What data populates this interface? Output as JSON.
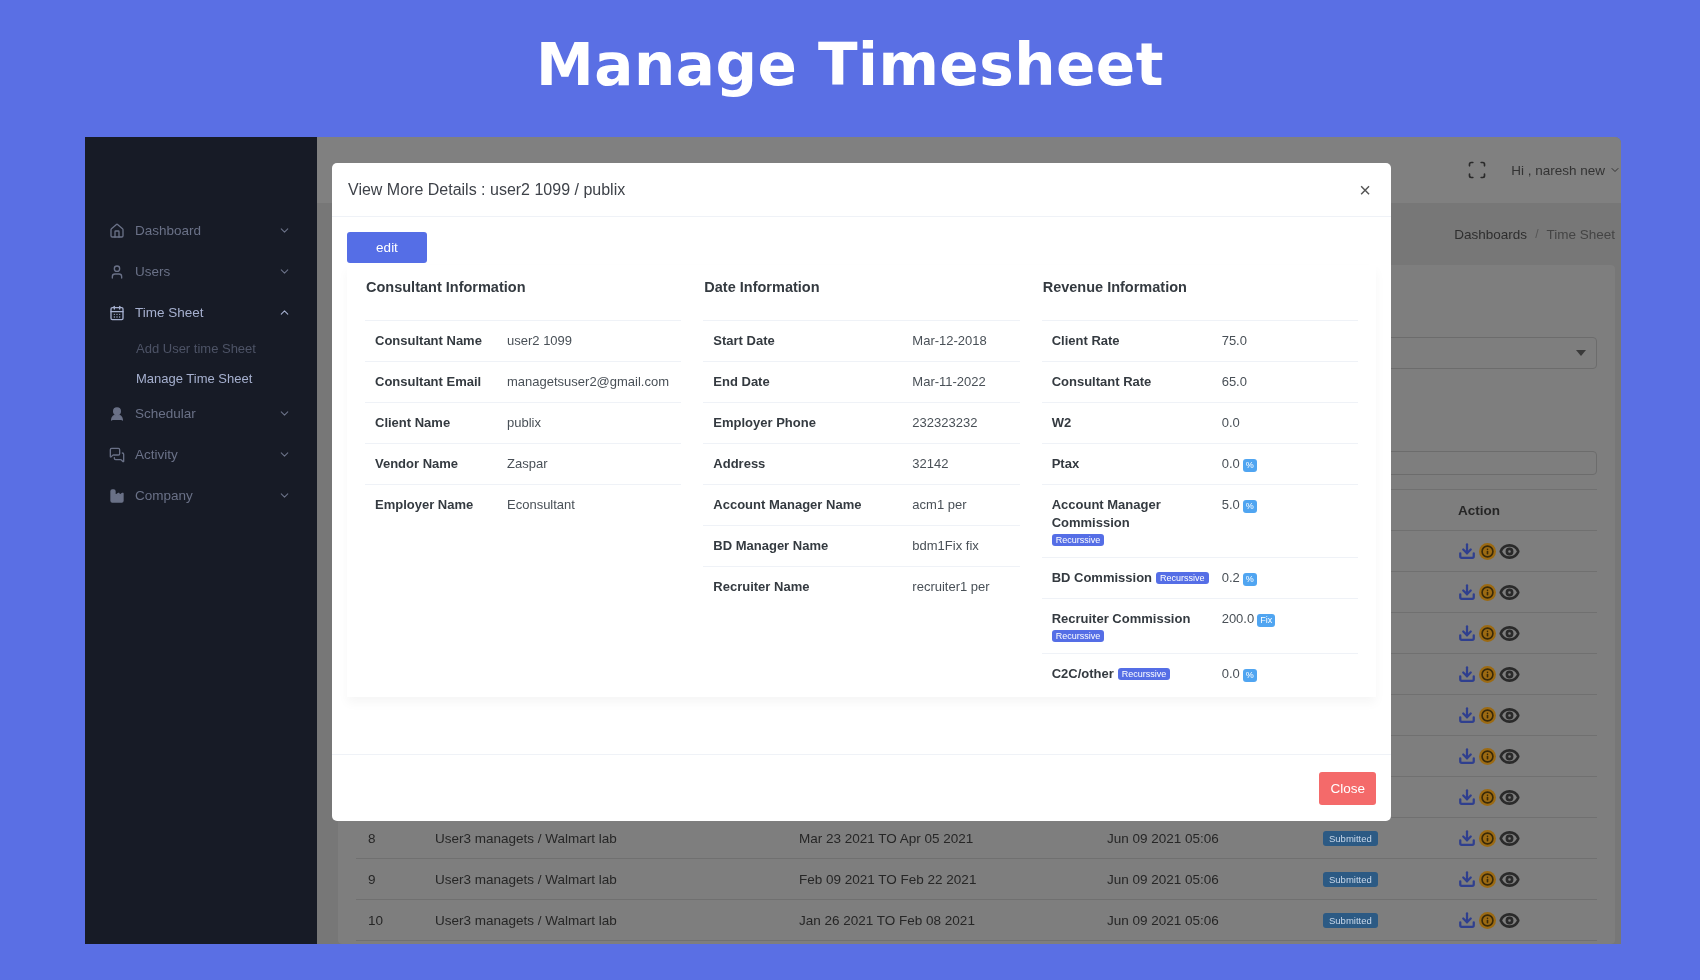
{
  "page_title": "Manage Timesheet",
  "sidebar": {
    "items": [
      {
        "label": "Dashboard",
        "expanded": false,
        "active": false
      },
      {
        "label": "Users",
        "expanded": false,
        "active": false
      },
      {
        "label": "Time Sheet",
        "expanded": true,
        "active": true,
        "children": [
          {
            "label": "Add User time Sheet",
            "selected": false
          },
          {
            "label": "Manage Time Sheet",
            "selected": true
          }
        ]
      },
      {
        "label": "Schedular",
        "expanded": false,
        "active": false
      },
      {
        "label": "Activity",
        "expanded": false,
        "active": false
      },
      {
        "label": "Company",
        "expanded": false,
        "active": false
      }
    ]
  },
  "header": {
    "greeting": "Hi , naresh new"
  },
  "breadcrumb": [
    "Dashboards",
    "Time Sheet"
  ],
  "breadcrumb_separator": "/",
  "table": {
    "columns": [
      "Action"
    ],
    "rows": [
      {
        "kind": "covered"
      },
      {
        "kind": "covered"
      },
      {
        "kind": "covered"
      },
      {
        "kind": "covered"
      },
      {
        "kind": "covered"
      },
      {
        "kind": "covered"
      },
      {
        "kind": "covered"
      },
      {
        "kind": "full",
        "number": "8",
        "name": "User3 managets / Walmart lab",
        "period": "Mar 23 2021 TO Apr 05 2021",
        "submitted_at": "Jun 09 2021 05:06",
        "status": "Submitted"
      },
      {
        "kind": "full",
        "number": "9",
        "name": "User3 managets / Walmart lab",
        "period": "Feb 09 2021 TO Feb 22 2021",
        "submitted_at": "Jun 09 2021 05:06",
        "status": "Submitted"
      },
      {
        "kind": "full",
        "number": "10",
        "name": "User3 managets / Walmart lab",
        "period": "Jan 26 2021 TO Feb 08 2021",
        "submitted_at": "Jun 09 2021 05:06",
        "status": "Submitted"
      }
    ]
  },
  "modal": {
    "title": "View More Details : user2 1099 / publix",
    "close_icon": "×",
    "edit_button": "edit",
    "close_button": "Close",
    "sections": [
      {
        "title": "Consultant Information",
        "rows": [
          {
            "label": "Consultant Name",
            "value": "user2 1099"
          },
          {
            "label": "Consultant Email",
            "value": "managetsuser2@gmail.com"
          },
          {
            "label": "Client Name",
            "value": "publix"
          },
          {
            "label": "Vendor Name",
            "value": "Zaspar"
          },
          {
            "label": "Employer Name",
            "value": "Econsultant"
          }
        ]
      },
      {
        "title": "Date Information",
        "rows": [
          {
            "label": "Start Date",
            "value": "Mar-12-2018"
          },
          {
            "label": "End Date",
            "value": "Mar-11-2022"
          },
          {
            "label": "Employer Phone",
            "value": "232323232"
          },
          {
            "label": "Address",
            "value": "32142"
          },
          {
            "label": "Account Manager Name",
            "value": "acm1 per"
          },
          {
            "label": "BD Manager Name",
            "value": "bdm1Fix fix"
          },
          {
            "label": "Recruiter Name",
            "value": "recruiter1 per"
          }
        ]
      },
      {
        "title": "Revenue Information",
        "rows": [
          {
            "label": "Client Rate",
            "value": "75.0"
          },
          {
            "label": "Consultant Rate",
            "value": "65.0"
          },
          {
            "label": "W2",
            "value": "0.0"
          },
          {
            "label": "Ptax",
            "value": "0.0",
            "unit": "%"
          },
          {
            "label": "Account Manager Commission",
            "tag": "Recurssive",
            "value": "5.0",
            "unit": "%"
          },
          {
            "label": "BD Commission",
            "tag": "Recurssive",
            "value": "0.2",
            "unit": "%"
          },
          {
            "label": "Recruiter Commission",
            "tag": "Recurssive",
            "value": "200.0",
            "unit": "Fix"
          },
          {
            "label": "C2C/other",
            "tag": "Recurssive",
            "value": "0.0",
            "unit": "%"
          }
        ]
      }
    ]
  }
}
